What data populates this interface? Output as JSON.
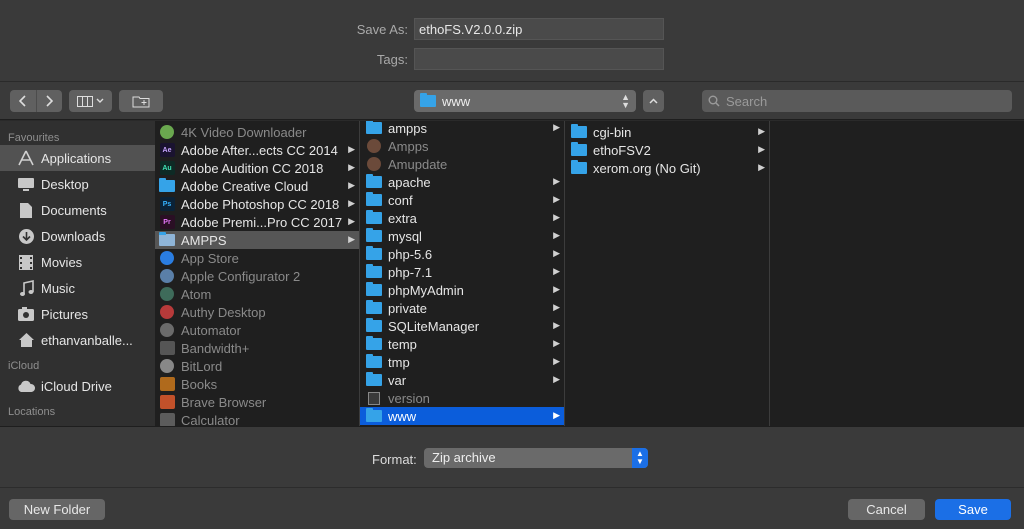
{
  "header": {
    "save_as_label": "Save As:",
    "save_as_value": "ethoFS.V2.0.0.zip",
    "tags_label": "Tags:",
    "tags_value": ""
  },
  "toolbar": {
    "back_icon": "chevron-left",
    "forward_icon": "chevron-right",
    "location": "www",
    "search_placeholder": "Search"
  },
  "sidebar": {
    "favourites_label": "Favourites",
    "favourites": [
      {
        "label": "Applications",
        "icon": "applications-icon"
      },
      {
        "label": "Desktop",
        "icon": "desktop-icon"
      },
      {
        "label": "Documents",
        "icon": "documents-icon"
      },
      {
        "label": "Downloads",
        "icon": "downloads-icon"
      },
      {
        "label": "Movies",
        "icon": "movies-icon"
      },
      {
        "label": "Music",
        "icon": "music-icon"
      },
      {
        "label": "Pictures",
        "icon": "pictures-icon"
      },
      {
        "label": "ethanvanballe...",
        "icon": "home-icon"
      }
    ],
    "icloud_label": "iCloud",
    "icloud": [
      {
        "label": "iCloud Drive",
        "icon": "cloud-icon"
      }
    ],
    "locations_label": "Locations"
  },
  "columns": {
    "apps": [
      {
        "label": "4K Video Downloader",
        "dim": true
      },
      {
        "label": "Adobe After...ects CC 2014",
        "dim": false,
        "folder": true
      },
      {
        "label": "Adobe Audition CC 2018",
        "dim": false,
        "folder": true
      },
      {
        "label": "Adobe Creative Cloud",
        "dim": false,
        "folder": true
      },
      {
        "label": "Adobe Photoshop CC 2018",
        "dim": false,
        "folder": true
      },
      {
        "label": "Adobe Premi...Pro CC 2017",
        "dim": false,
        "folder": true
      },
      {
        "label": "AMPPS",
        "dim": false,
        "folder": true
      },
      {
        "label": "App Store",
        "dim": true
      },
      {
        "label": "Apple Configurator 2",
        "dim": true
      },
      {
        "label": "Atom",
        "dim": true
      },
      {
        "label": "Authy Desktop",
        "dim": true
      },
      {
        "label": "Automator",
        "dim": true
      },
      {
        "label": "Bandwidth+",
        "dim": true
      },
      {
        "label": "BitLord",
        "dim": true
      },
      {
        "label": "Books",
        "dim": true
      },
      {
        "label": "Brave Browser",
        "dim": true
      },
      {
        "label": "Calculator",
        "dim": true
      }
    ],
    "ampps": [
      {
        "label": "ampps",
        "dim": false
      },
      {
        "label": "Ampps",
        "dim": true
      },
      {
        "label": "Amupdate",
        "dim": true
      },
      {
        "label": "apache",
        "dim": false
      },
      {
        "label": "conf",
        "dim": false
      },
      {
        "label": "extra",
        "dim": false
      },
      {
        "label": "mysql",
        "dim": false
      },
      {
        "label": "php-5.6",
        "dim": false
      },
      {
        "label": "php-7.1",
        "dim": false
      },
      {
        "label": "phpMyAdmin",
        "dim": false
      },
      {
        "label": "private",
        "dim": false
      },
      {
        "label": "SQLiteManager",
        "dim": false
      },
      {
        "label": "temp",
        "dim": false
      },
      {
        "label": "tmp",
        "dim": false
      },
      {
        "label": "var",
        "dim": false
      },
      {
        "label": "version",
        "dim": true
      },
      {
        "label": "www",
        "dim": false
      }
    ],
    "www": [
      {
        "label": "cgi-bin"
      },
      {
        "label": "ethoFSV2"
      },
      {
        "label": "xerom.org (No Git)"
      }
    ]
  },
  "footer": {
    "format_label": "Format:",
    "format_value": "Zip archive",
    "new_folder_label": "New Folder",
    "cancel_label": "Cancel",
    "save_label": "Save"
  },
  "colors": {
    "selection_blue": "#0b5ddb",
    "folder_blue": "#35a3e8",
    "save_button": "#1b6fe6"
  }
}
